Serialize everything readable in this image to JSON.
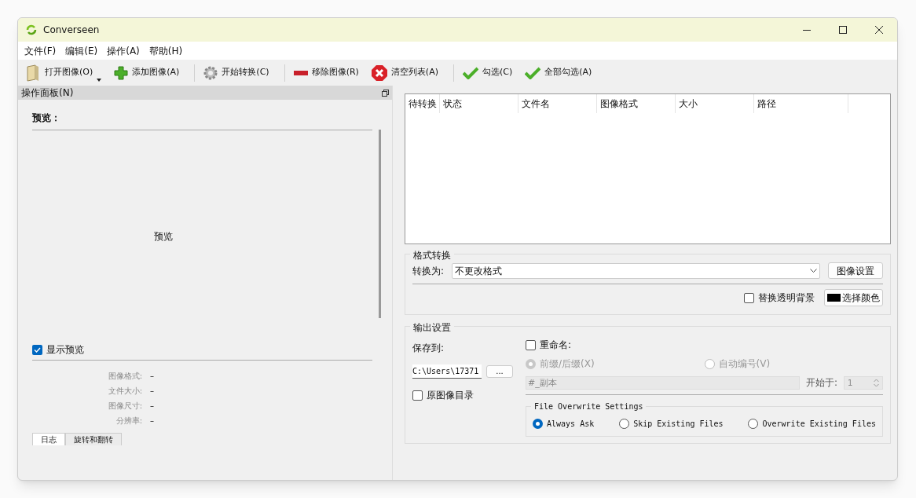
{
  "window": {
    "title": "Converseen"
  },
  "menu": [
    "文件(F)",
    "编辑(E)",
    "操作(A)",
    "帮助(H)"
  ],
  "toolbar": [
    {
      "kind": "open",
      "label": "打开图像(O)",
      "dropdown": true
    },
    {
      "kind": "add",
      "label": "添加图像(A)"
    },
    {
      "kind": "convert",
      "label": "开始转换(C)"
    },
    {
      "kind": "remove",
      "label": "移除图像(R)"
    },
    {
      "kind": "clear",
      "label": "清空列表(A)"
    },
    {
      "kind": "check",
      "label": "勾选(C)"
    },
    {
      "kind": "check",
      "label": "全部勾选(A)"
    }
  ],
  "panel": {
    "title": "操作面板(N)",
    "preview_heading": "预览：",
    "preview_text": "预览",
    "show_preview": {
      "label": "显示预览",
      "checked": true
    },
    "info": [
      {
        "label": "图像格式:",
        "value": "–"
      },
      {
        "label": "文件大小:",
        "value": "–"
      },
      {
        "label": "图像尺寸:",
        "value": "–"
      },
      {
        "label": "分辨率:",
        "value": "–"
      }
    ],
    "tabs": [
      {
        "label": "日志",
        "selected": true
      },
      {
        "label": "旋转和翻转",
        "selected": false
      }
    ]
  },
  "table": {
    "columns": [
      "待转换",
      "状态",
      "文件名",
      "图像格式",
      "大小",
      "路径"
    ]
  },
  "format": {
    "title": "格式转换",
    "convert_label": "转换为:",
    "convert_value": "不更改格式",
    "settings_button": "图像设置",
    "replace_bg": {
      "label": "替换透明背景",
      "checked": false
    },
    "color_button": "选择颜色",
    "color": "#000000"
  },
  "output": {
    "title": "输出设置",
    "save_label": "保存到:",
    "path": "C:\\Users\\17371",
    "browse": "...",
    "original_dir": {
      "label": "原图像目录",
      "checked": false
    },
    "rename": {
      "label": "重命名:",
      "checked": false
    },
    "rename_modes": [
      {
        "label": "前缀/后缀(X)",
        "selected": true,
        "disabled": true
      },
      {
        "label": "自动编号(V)",
        "selected": false,
        "disabled": true
      }
    ],
    "pattern": "#_副本",
    "start_label": "开始于:",
    "start_value": "1",
    "overwrite": {
      "title": "File Overwrite Settings",
      "options": [
        {
          "label": "Always Ask",
          "selected": true
        },
        {
          "label": "Skip Existing Files",
          "selected": false
        },
        {
          "label": "Overwrite Existing Files",
          "selected": false
        }
      ]
    }
  }
}
